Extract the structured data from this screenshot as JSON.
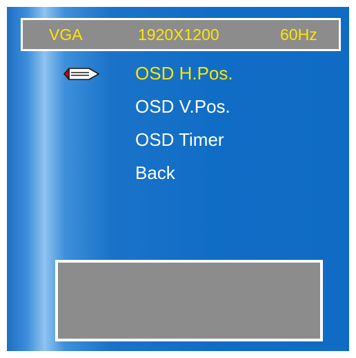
{
  "status": {
    "signal": "VGA",
    "resolution": "1920X1200",
    "refresh": "60Hz"
  },
  "menu": {
    "selected_index": 0,
    "items": [
      {
        "label": "OSD H.Pos."
      },
      {
        "label": "OSD V.Pos."
      },
      {
        "label": "OSD Timer"
      },
      {
        "label": "Back"
      }
    ]
  },
  "icons": {
    "pointer": "pencil-pointer-icon"
  },
  "colors": {
    "highlight": "#ffe600",
    "text": "#ffffff",
    "panel_gray": "#8c8c8c",
    "background_blue": "#106dc6",
    "pointer_tip": "#e00000"
  }
}
